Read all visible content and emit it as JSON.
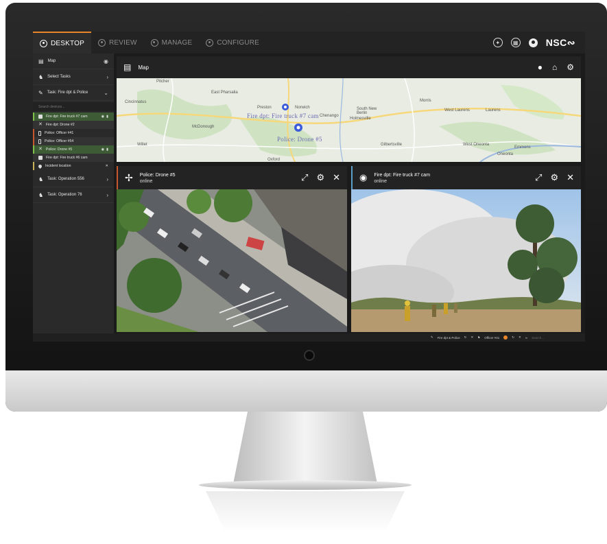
{
  "nav": {
    "tabs": [
      {
        "label": "DESKTOP",
        "active": true
      },
      {
        "label": "REVIEW",
        "active": false
      },
      {
        "label": "MANAGE",
        "active": false
      },
      {
        "label": "CONFIGURE",
        "active": false
      }
    ],
    "brand": "NSC"
  },
  "sidebar": {
    "map": "Map",
    "select_tasks": "Select Tasks",
    "task_current": "Task: Fire dpt & Police",
    "search_placeholder": "Search devices...",
    "devices": [
      {
        "label": "Fire dpt: Fire truck #7 cam",
        "icon": "camera-icon",
        "highlight": true
      },
      {
        "label": "Fire dpt: Drone #2",
        "icon": "drone-icon",
        "highlight": false
      },
      {
        "label": "Police: Officer #41",
        "icon": "phone-icon",
        "highlight": false
      },
      {
        "label": "Police: Officer #54",
        "icon": "phone-icon",
        "highlight": false
      },
      {
        "label": "Police: Drone #5",
        "icon": "drone-icon",
        "highlight": true
      },
      {
        "label": "Fire dpt: Fire truck #6 cam",
        "icon": "camera-icon",
        "highlight": false
      },
      {
        "label": "Incident location",
        "icon": "pin-icon",
        "highlight": false
      }
    ],
    "tasks_below": [
      "Task: Operation 556",
      "Task: Operation 76"
    ]
  },
  "map_panel": {
    "title": "Map",
    "places": [
      "Cincinnatus",
      "Pitcher",
      "East Pharsalia",
      "Preston",
      "Norwich",
      "Chenango",
      "South New Berlin",
      "Morris",
      "West Laurens",
      "Laurens",
      "McDonough",
      "Holmesville",
      "Gilbertsville",
      "West Oneonta",
      "Oneonta",
      "Emmons",
      "Oxford",
      "Willet"
    ],
    "callouts": [
      "Fire dpt: Fire truck #7 cam",
      "Police: Drone #5"
    ]
  },
  "video_left": {
    "title": "Police: Drone #5",
    "status": "online"
  },
  "video_right": {
    "title": "Fire dpt: Fire truck #7 cam",
    "status": "online"
  },
  "statusbar": {
    "task": "Fire dpt & Police",
    "officer": "Officer #41",
    "search_placeholder": "Search..."
  },
  "colors": {
    "accent": "#e8862b",
    "highlight": "#3d5c35",
    "marker": "#3b5bdb"
  }
}
